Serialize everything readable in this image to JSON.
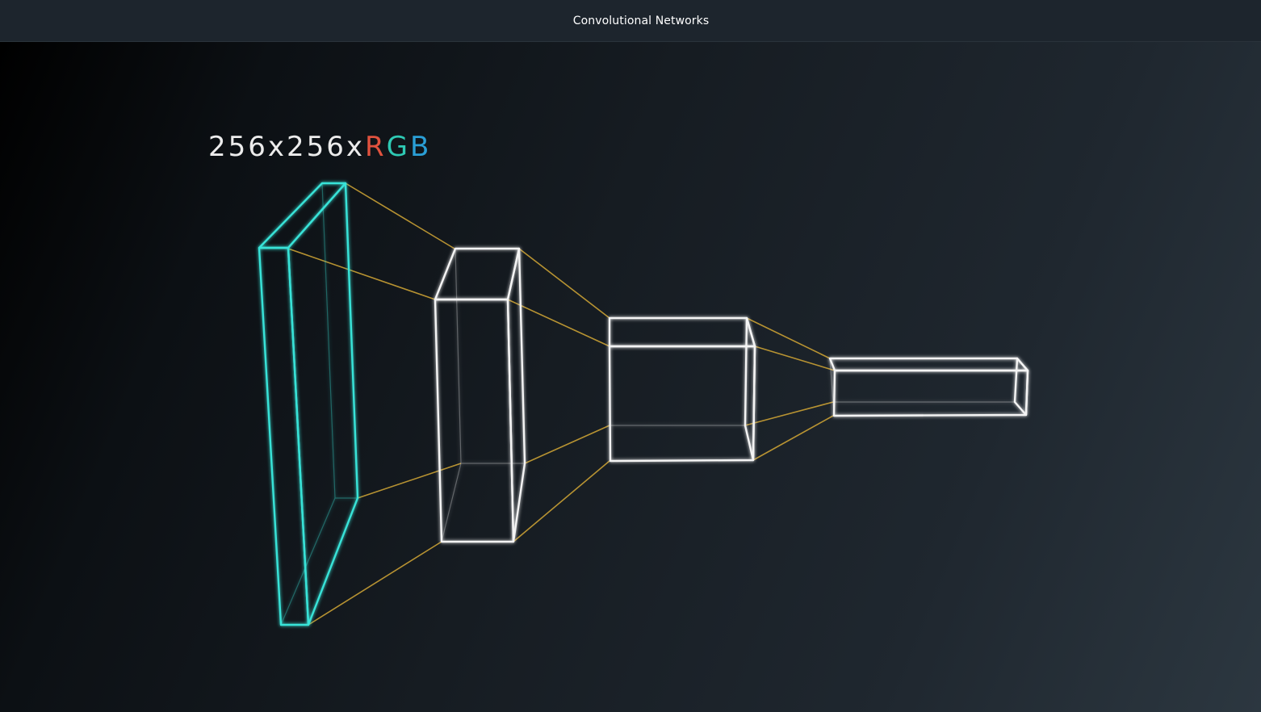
{
  "window": {
    "title": "Convolutional Networks"
  },
  "diagram": {
    "input_label": {
      "dims": "256x256x",
      "r": "R",
      "g": "G",
      "b": "B"
    },
    "colors": {
      "input_layer": "#39e3d8",
      "layers": "#f4f4f4",
      "connectors": "#c9a034",
      "r": "#e0523e",
      "g": "#2ec9b4",
      "b": "#2a9fd6"
    }
  }
}
